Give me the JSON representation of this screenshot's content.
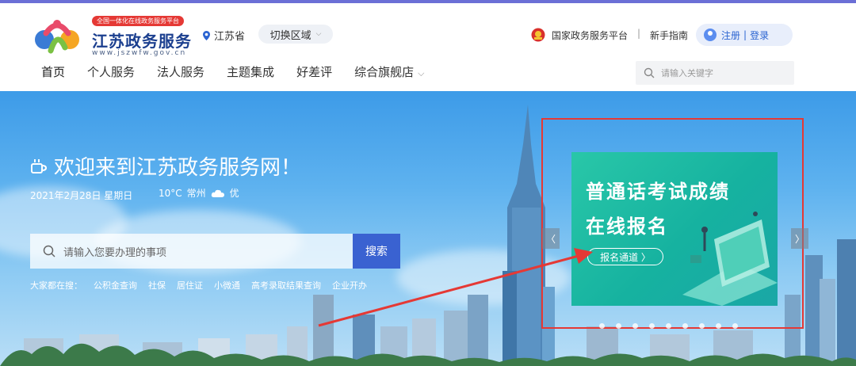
{
  "header": {
    "logo_badge": "全国一体化在线政务服务平台",
    "logo_title": "江苏政务服务",
    "logo_url": "www.jszwfw.gov.cn",
    "region": "江苏省",
    "switch_region": "切换区域",
    "gov_platform": "国家政务服务平台",
    "separator": "|",
    "guide": "新手指南",
    "register": "注册",
    "auth_separator": "|",
    "login": "登录"
  },
  "nav": {
    "items": [
      {
        "label": "首页",
        "active": true
      },
      {
        "label": "个人服务"
      },
      {
        "label": "法人服务"
      },
      {
        "label": "主题集成"
      },
      {
        "label": "好差评"
      },
      {
        "label": "综合旗舰店"
      }
    ],
    "search_placeholder": "请输入关键字"
  },
  "hero": {
    "welcome": "欢迎来到江苏政务服务网！",
    "date": "2021年2月28日 星期日",
    "temperature": "10°C",
    "city": "常州",
    "air_quality": "优",
    "search_placeholder": "请输入您要办理的事项",
    "search_button": "搜索",
    "hot_label": "大家都在搜：",
    "hot_items": [
      "公积金查询",
      "社保",
      "居住证",
      "小微通",
      "高考录取结果查询",
      "企业开办"
    ]
  },
  "promo": {
    "line1": "普通话考试成绩",
    "line2": "在线报名",
    "button": "报名通道 〉"
  },
  "colors": {
    "accent": "#2b64d1",
    "highlight_box": "#e53935",
    "promo_bg": "#16b2a0"
  },
  "carousel": {
    "slide_count": 9
  }
}
